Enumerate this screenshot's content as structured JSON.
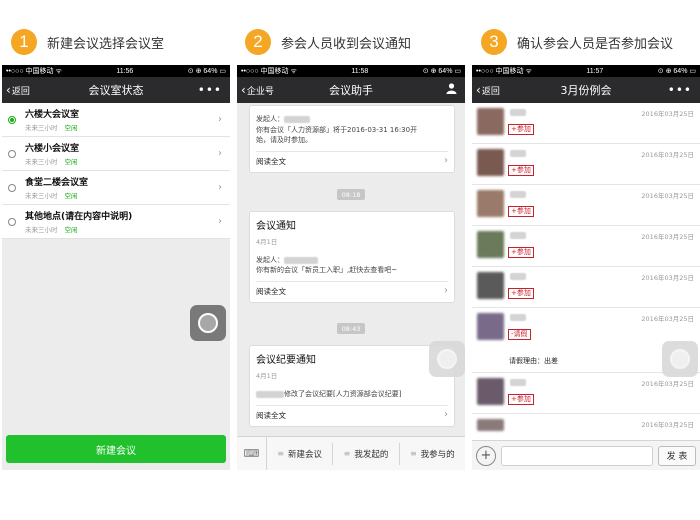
{
  "steps": [
    {
      "num": "1",
      "text": "新建会议选择会议室"
    },
    {
      "num": "2",
      "text": "参会人员收到会议通知"
    },
    {
      "num": "3",
      "text": "确认参会人员是否参加会议"
    }
  ],
  "phone1": {
    "status": {
      "carrier": "••○○○ 中国移动 ᯤ",
      "time": "11:56",
      "battery": "⊙ ⊕ 64% ▭"
    },
    "nav": {
      "back": "返回",
      "title": "会议室状态",
      "more": "•••"
    },
    "rooms": [
      {
        "name": "六楼大会议室",
        "sub": "未来三小时",
        "status": "空闲",
        "selected": true
      },
      {
        "name": "六楼小会议室",
        "sub": "未来三小时",
        "status": "空闲",
        "selected": false
      },
      {
        "name": "食堂二楼会议室",
        "sub": "未来三小时",
        "status": "空闲",
        "selected": false
      },
      {
        "name": "其他地点(请在内容中说明)",
        "sub": "未来三小时",
        "status": "空闲",
        "selected": false
      }
    ],
    "button": "新建会议"
  },
  "phone2": {
    "status": {
      "carrier": "••○○○ 中国移动 ᯤ",
      "time": "11:58",
      "battery": "⊙ ⊕ 64% ▭"
    },
    "nav": {
      "back": "企业号",
      "title": "会议助手",
      "user_icon": "user-icon"
    },
    "card1": {
      "initiator": "发起人：",
      "line1": "你有会议「人力资源部」将于2016-03-31 16:30开",
      "line2": "始，请及时参加。",
      "read": "阅读全文"
    },
    "time1": "08:18",
    "card2": {
      "title": "会议通知",
      "date": "4月1日",
      "initiator": "发起人：",
      "line1": "你有新的会议「新员工入职」,赶快去查看吧~",
      "read": "阅读全文"
    },
    "time2": "08:43",
    "card3": {
      "title": "会议纪要通知",
      "date": "4月1日",
      "line1": "修改了会议纪要[人力资源部会议纪要]",
      "read": "阅读全文"
    },
    "tabs": [
      "新建会议",
      "我发起的",
      "我参与的"
    ]
  },
  "phone3": {
    "status": {
      "carrier": "••○○○ 中国移动 ᯤ",
      "time": "11:57",
      "battery": "⊙ ⊕ 64% ▭"
    },
    "nav": {
      "back": "返回",
      "title": "3月份例会",
      "more": "•••"
    },
    "members": [
      {
        "stamp": "+参加",
        "date": "2016年03月25日",
        "color": "#8a6a60"
      },
      {
        "stamp": "+参加",
        "date": "2016年03月25日",
        "color": "#7a5a50"
      },
      {
        "stamp": "+参加",
        "date": "2016年03月25日",
        "color": "#9a7a6a"
      },
      {
        "stamp": "+参加",
        "date": "2016年03月25日",
        "color": "#6a7a5a"
      },
      {
        "stamp": "+参加",
        "date": "2016年03月25日",
        "color": "#5a5a5a"
      },
      {
        "stamp": "-请假",
        "date": "2016年03月25日",
        "color": "#7a6a8a",
        "reason": "请假理由：出差"
      },
      {
        "stamp": "+参加",
        "date": "2016年03月25日",
        "color": "#6a5a6a"
      },
      {
        "stamp": "",
        "date": "2016年03月25日",
        "color": "#8a7a7a"
      }
    ],
    "send": "发 表",
    "plus": "+"
  }
}
